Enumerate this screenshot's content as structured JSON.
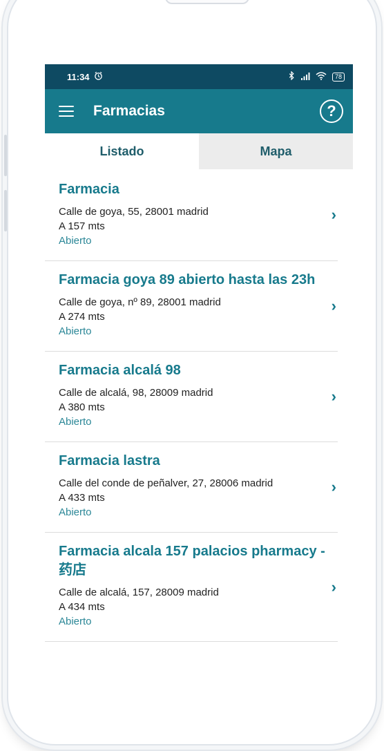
{
  "status_bar": {
    "time": "11:34",
    "alarm_icon": "alarm-icon",
    "bluetooth_icon": "bluetooth-icon",
    "signal_icon": "signal-icon",
    "wifi_icon": "wifi-icon",
    "battery": "78"
  },
  "app_bar": {
    "title": "Farmacias",
    "menu_icon": "menu-icon",
    "help_icon": "help-icon",
    "help_glyph": "?"
  },
  "tabs": [
    {
      "label": "Listado",
      "active": true
    },
    {
      "label": "Mapa",
      "active": false
    }
  ],
  "pharmacies": [
    {
      "name": "Farmacia",
      "address": "Calle de goya, 55, 28001 madrid",
      "distance": "A 157 mts",
      "status": "Abierto"
    },
    {
      "name": "Farmacia goya 89 abierto hasta las 23h",
      "address": "Calle de goya, nº 89, 28001 madrid",
      "distance": "A 274 mts",
      "status": "Abierto"
    },
    {
      "name": "Farmacia alcalá 98",
      "address": "Calle de alcalá, 98, 28009 madrid",
      "distance": "A 380 mts",
      "status": "Abierto"
    },
    {
      "name": "Farmacia lastra",
      "address": "Calle del conde de peñalver, 27, 28006 madrid",
      "distance": "A 433 mts",
      "status": "Abierto"
    },
    {
      "name": "Farmacia alcala 157 palacios pharmacy -药店",
      "address": "Calle de alcalá, 157, 28009 madrid",
      "distance": "A 434 mts",
      "status": "Abierto"
    }
  ],
  "colors": {
    "status_bar": "#0e4a62",
    "app_bar": "#177a8c",
    "accent": "#177a8c",
    "inactive_tab": "#ececec"
  }
}
